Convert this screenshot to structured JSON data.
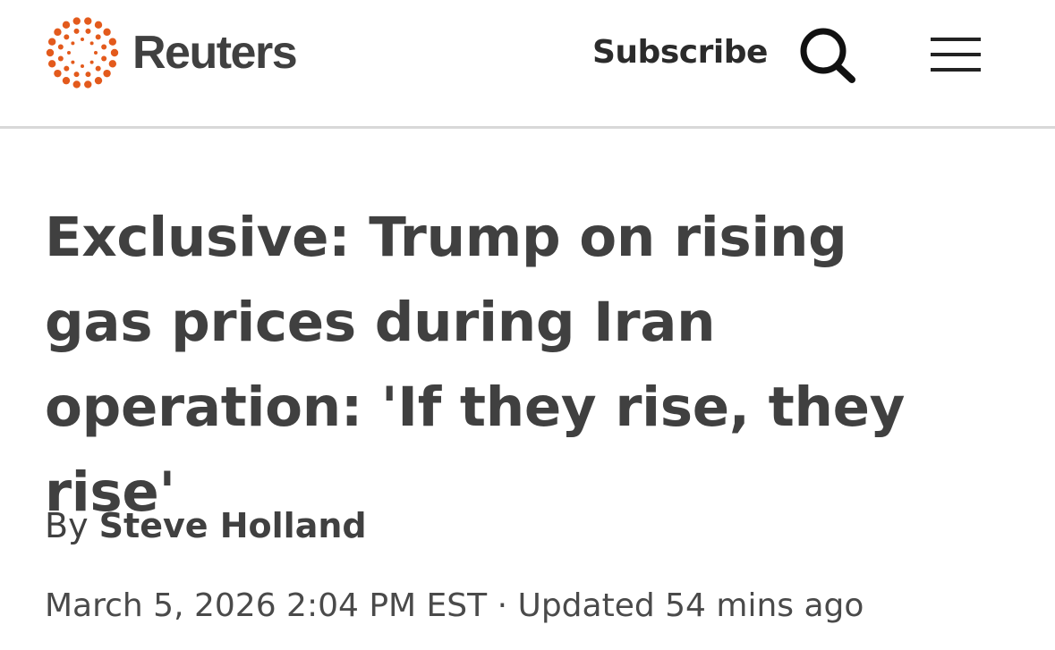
{
  "header": {
    "brand": "Reuters",
    "logo_color": "#e35a1c",
    "subscribe_label": "Subscribe",
    "search_icon": "search-icon",
    "menu_icon": "hamburger-menu-icon"
  },
  "article": {
    "headline": "Exclusive: Trump on rising gas prices during Iran operation: 'If they rise, they rise'",
    "byline_prefix": "By",
    "author": "Steve Holland",
    "published": "March 5, 2026 2:04 PM EST",
    "separator": "·",
    "updated": "Updated 54 mins ago"
  }
}
